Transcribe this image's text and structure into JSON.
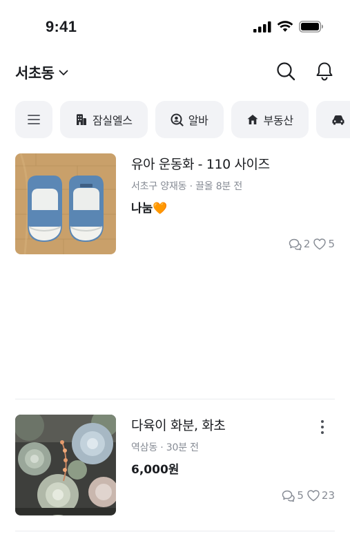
{
  "status_bar": {
    "time": "9:41"
  },
  "header": {
    "location": "서초동"
  },
  "chips": [
    {
      "label": "잠실엘스",
      "icon": "building-icon"
    },
    {
      "label": "알바",
      "icon": "search-person-icon"
    },
    {
      "label": "부동산",
      "icon": "house-icon"
    }
  ],
  "listings": [
    {
      "title": "유아 운동화 - 110 사이즈",
      "meta": "서초구 양재동 · 끌올 8분 전",
      "price": "나눔🧡",
      "chats": "2",
      "likes": "5"
    },
    {
      "title": "다육이 화분, 화초",
      "meta": "역삼동 · 30분 전",
      "price": "6,000원",
      "chats": "5",
      "likes": "23"
    }
  ]
}
